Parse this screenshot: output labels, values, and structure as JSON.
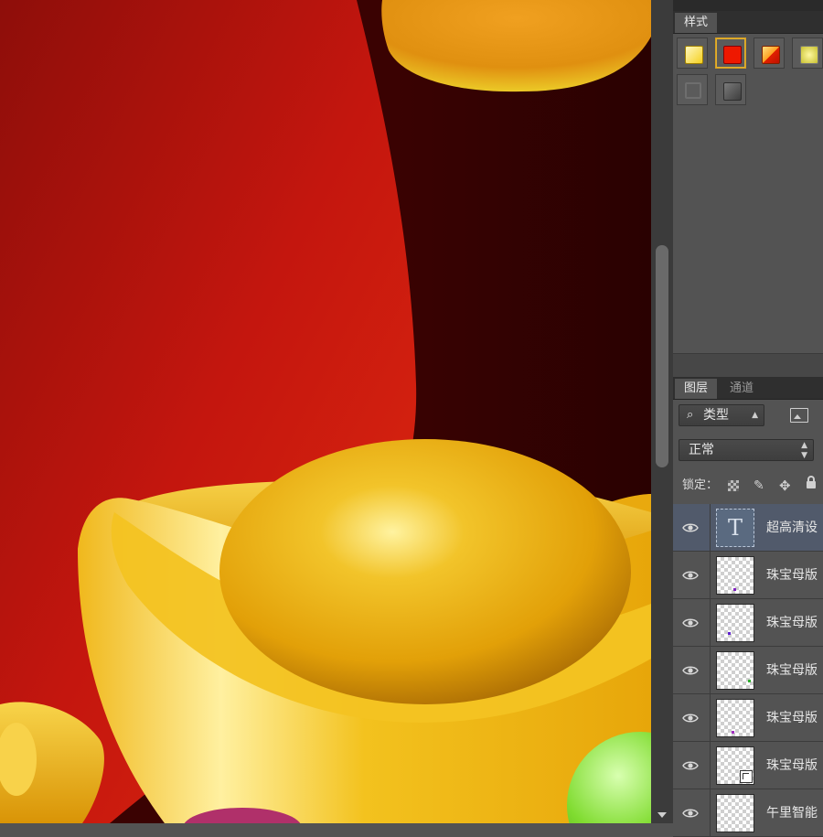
{
  "panels": {
    "styles": {
      "tab_label": "样式",
      "swatches": [
        "yellow-gradient-style",
        "red-style",
        "orange-red-diagonal-style",
        "yellow-glow-style",
        "grey-outline-style",
        "grey-bevel-style"
      ]
    },
    "layers": {
      "tabs": [
        "图层",
        "通道"
      ],
      "filter_label": "类型",
      "blend_mode": "正常",
      "lock_label": "锁定：",
      "rows": [
        {
          "name": "超高清设",
          "type": "text",
          "thumb": "T"
        },
        {
          "name": "珠宝母版",
          "type": "image"
        },
        {
          "name": "珠宝母版",
          "type": "image"
        },
        {
          "name": "珠宝母版",
          "type": "image"
        },
        {
          "name": "珠宝母版",
          "type": "image"
        },
        {
          "name": "珠宝母版",
          "type": "smart-object"
        },
        {
          "name": "午里智能",
          "type": "image"
        }
      ]
    }
  },
  "colors": {
    "canvas_bg": "#3a0202",
    "red_shape": "#c8140c",
    "gold": "#e8a810",
    "panel_bg": "#535353",
    "selected_row": "#515a6b"
  }
}
